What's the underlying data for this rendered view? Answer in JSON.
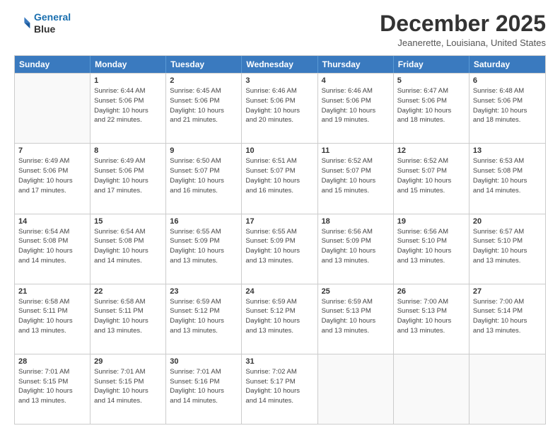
{
  "logo": {
    "line1": "General",
    "line2": "Blue"
  },
  "title": "December 2025",
  "location": "Jeanerette, Louisiana, United States",
  "header": {
    "days": [
      "Sunday",
      "Monday",
      "Tuesday",
      "Wednesday",
      "Thursday",
      "Friday",
      "Saturday"
    ]
  },
  "weeks": [
    [
      {
        "day": "",
        "info": ""
      },
      {
        "day": "1",
        "info": "Sunrise: 6:44 AM\nSunset: 5:06 PM\nDaylight: 10 hours\nand 22 minutes."
      },
      {
        "day": "2",
        "info": "Sunrise: 6:45 AM\nSunset: 5:06 PM\nDaylight: 10 hours\nand 21 minutes."
      },
      {
        "day": "3",
        "info": "Sunrise: 6:46 AM\nSunset: 5:06 PM\nDaylight: 10 hours\nand 20 minutes."
      },
      {
        "day": "4",
        "info": "Sunrise: 6:46 AM\nSunset: 5:06 PM\nDaylight: 10 hours\nand 19 minutes."
      },
      {
        "day": "5",
        "info": "Sunrise: 6:47 AM\nSunset: 5:06 PM\nDaylight: 10 hours\nand 18 minutes."
      },
      {
        "day": "6",
        "info": "Sunrise: 6:48 AM\nSunset: 5:06 PM\nDaylight: 10 hours\nand 18 minutes."
      }
    ],
    [
      {
        "day": "7",
        "info": "Sunrise: 6:49 AM\nSunset: 5:06 PM\nDaylight: 10 hours\nand 17 minutes."
      },
      {
        "day": "8",
        "info": "Sunrise: 6:49 AM\nSunset: 5:06 PM\nDaylight: 10 hours\nand 17 minutes."
      },
      {
        "day": "9",
        "info": "Sunrise: 6:50 AM\nSunset: 5:07 PM\nDaylight: 10 hours\nand 16 minutes."
      },
      {
        "day": "10",
        "info": "Sunrise: 6:51 AM\nSunset: 5:07 PM\nDaylight: 10 hours\nand 16 minutes."
      },
      {
        "day": "11",
        "info": "Sunrise: 6:52 AM\nSunset: 5:07 PM\nDaylight: 10 hours\nand 15 minutes."
      },
      {
        "day": "12",
        "info": "Sunrise: 6:52 AM\nSunset: 5:07 PM\nDaylight: 10 hours\nand 15 minutes."
      },
      {
        "day": "13",
        "info": "Sunrise: 6:53 AM\nSunset: 5:08 PM\nDaylight: 10 hours\nand 14 minutes."
      }
    ],
    [
      {
        "day": "14",
        "info": "Sunrise: 6:54 AM\nSunset: 5:08 PM\nDaylight: 10 hours\nand 14 minutes."
      },
      {
        "day": "15",
        "info": "Sunrise: 6:54 AM\nSunset: 5:08 PM\nDaylight: 10 hours\nand 14 minutes."
      },
      {
        "day": "16",
        "info": "Sunrise: 6:55 AM\nSunset: 5:09 PM\nDaylight: 10 hours\nand 13 minutes."
      },
      {
        "day": "17",
        "info": "Sunrise: 6:55 AM\nSunset: 5:09 PM\nDaylight: 10 hours\nand 13 minutes."
      },
      {
        "day": "18",
        "info": "Sunrise: 6:56 AM\nSunset: 5:09 PM\nDaylight: 10 hours\nand 13 minutes."
      },
      {
        "day": "19",
        "info": "Sunrise: 6:56 AM\nSunset: 5:10 PM\nDaylight: 10 hours\nand 13 minutes."
      },
      {
        "day": "20",
        "info": "Sunrise: 6:57 AM\nSunset: 5:10 PM\nDaylight: 10 hours\nand 13 minutes."
      }
    ],
    [
      {
        "day": "21",
        "info": "Sunrise: 6:58 AM\nSunset: 5:11 PM\nDaylight: 10 hours\nand 13 minutes."
      },
      {
        "day": "22",
        "info": "Sunrise: 6:58 AM\nSunset: 5:11 PM\nDaylight: 10 hours\nand 13 minutes."
      },
      {
        "day": "23",
        "info": "Sunrise: 6:59 AM\nSunset: 5:12 PM\nDaylight: 10 hours\nand 13 minutes."
      },
      {
        "day": "24",
        "info": "Sunrise: 6:59 AM\nSunset: 5:12 PM\nDaylight: 10 hours\nand 13 minutes."
      },
      {
        "day": "25",
        "info": "Sunrise: 6:59 AM\nSunset: 5:13 PM\nDaylight: 10 hours\nand 13 minutes."
      },
      {
        "day": "26",
        "info": "Sunrise: 7:00 AM\nSunset: 5:13 PM\nDaylight: 10 hours\nand 13 minutes."
      },
      {
        "day": "27",
        "info": "Sunrise: 7:00 AM\nSunset: 5:14 PM\nDaylight: 10 hours\nand 13 minutes."
      }
    ],
    [
      {
        "day": "28",
        "info": "Sunrise: 7:01 AM\nSunset: 5:15 PM\nDaylight: 10 hours\nand 13 minutes."
      },
      {
        "day": "29",
        "info": "Sunrise: 7:01 AM\nSunset: 5:15 PM\nDaylight: 10 hours\nand 14 minutes."
      },
      {
        "day": "30",
        "info": "Sunrise: 7:01 AM\nSunset: 5:16 PM\nDaylight: 10 hours\nand 14 minutes."
      },
      {
        "day": "31",
        "info": "Sunrise: 7:02 AM\nSunset: 5:17 PM\nDaylight: 10 hours\nand 14 minutes."
      },
      {
        "day": "",
        "info": ""
      },
      {
        "day": "",
        "info": ""
      },
      {
        "day": "",
        "info": ""
      }
    ]
  ]
}
